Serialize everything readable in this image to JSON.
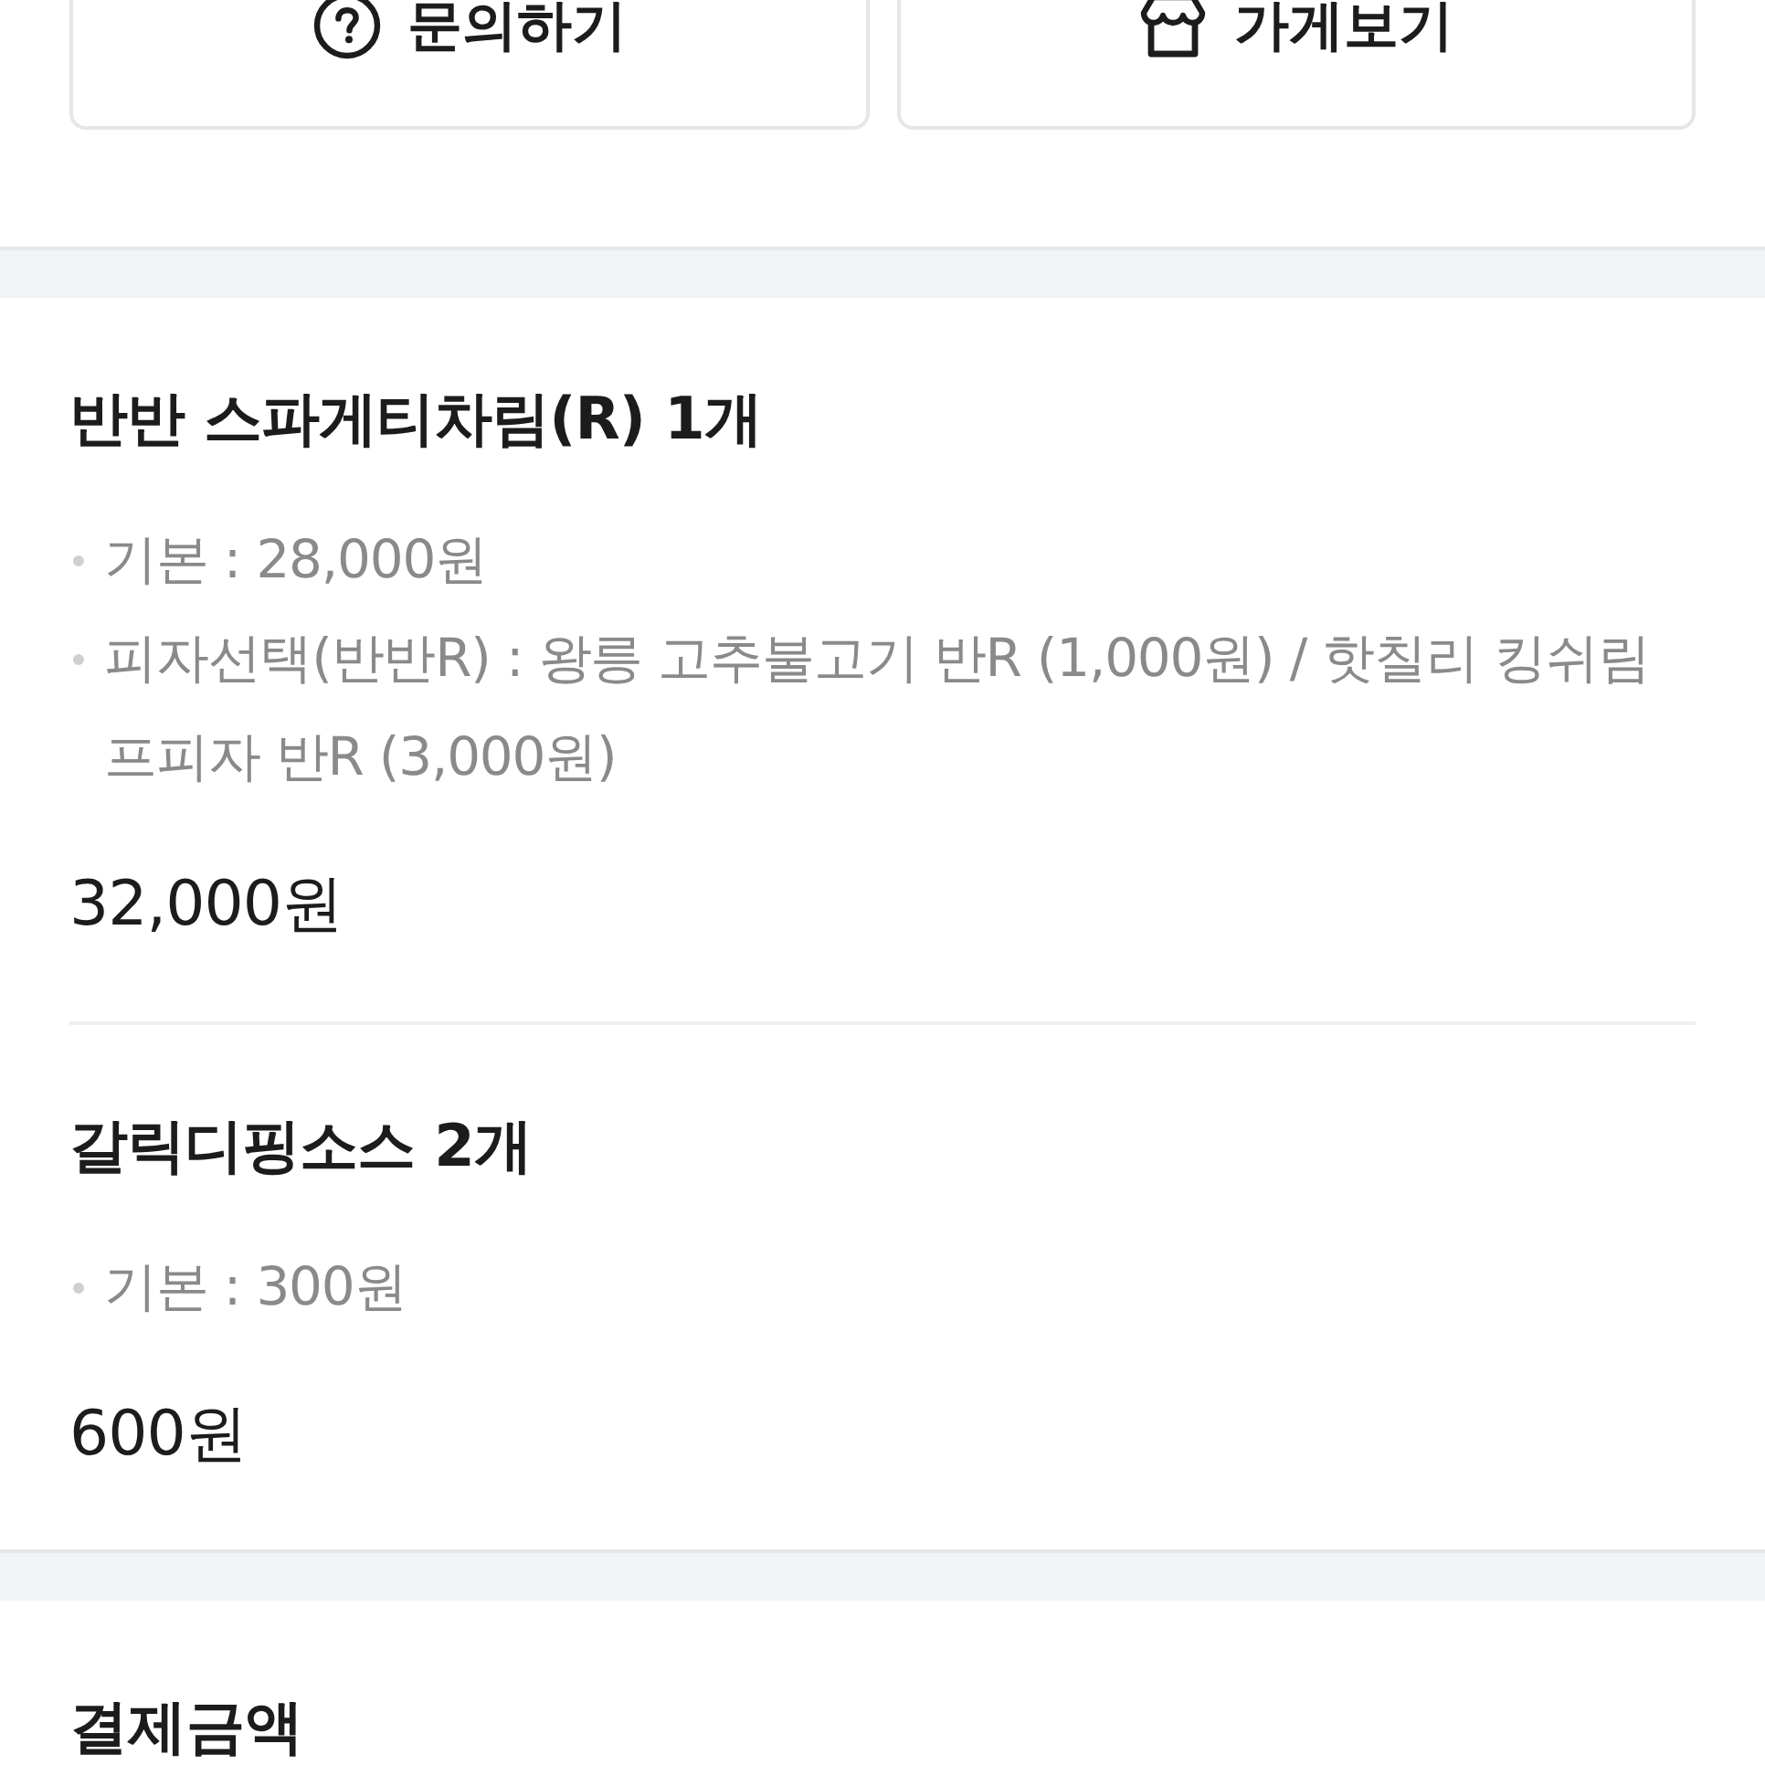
{
  "action_buttons": [
    {
      "kind": "inquiry",
      "label": "문의하기"
    },
    {
      "kind": "store",
      "label": "가게보기"
    }
  ],
  "order_items": [
    {
      "title": "반반 스파게티차림(R) 1개",
      "options": [
        "기본 : 28,000원",
        "피자선택(반반R) : 왕릉 고추불고기 반R (1,000원) / 핫칠리 킹쉬림프피자 반R (3,000원)"
      ],
      "price": "32,000원"
    },
    {
      "title": "갈릭디핑소스 2개",
      "options": [
        "기본 : 300원"
      ],
      "price": "600원"
    }
  ],
  "payment_section": {
    "title": "결제금액"
  }
}
